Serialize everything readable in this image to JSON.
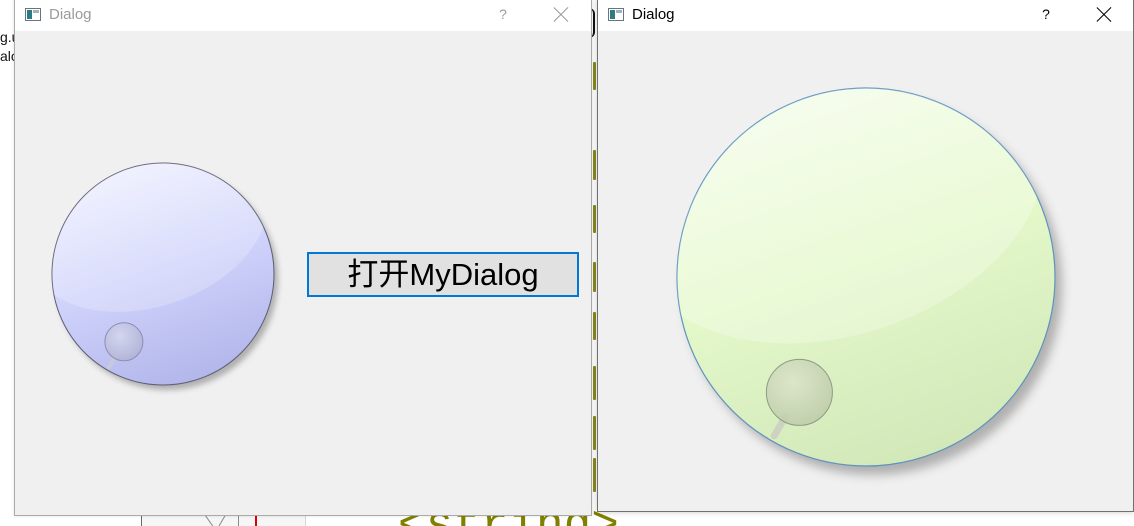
{
  "background": {
    "fragments": [
      {
        "text": "g.u"
      },
      {
        "text": "alo"
      }
    ],
    "code_text": "<string>",
    "colors": {
      "code": "#808000"
    }
  },
  "dialogs": {
    "main": {
      "title": "Dialog",
      "help_label": "?",
      "active": false,
      "title_color": "#9a9a9a",
      "icons": {
        "window": "window-icon",
        "close": "close-icon"
      },
      "dial": {
        "level_fraction": 0,
        "color": "#d0d3fb"
      },
      "button": {
        "label": "打开MyDialog",
        "focused": true,
        "focus_color": "#0078d7"
      }
    },
    "my_dialog": {
      "title": "Dialog",
      "help_label": "?",
      "active": true,
      "title_color": "#000000",
      "icons": {
        "window": "window-icon",
        "close": "close-icon"
      },
      "dial": {
        "level_fraction": 0,
        "color": "#e5f9cb"
      }
    }
  }
}
